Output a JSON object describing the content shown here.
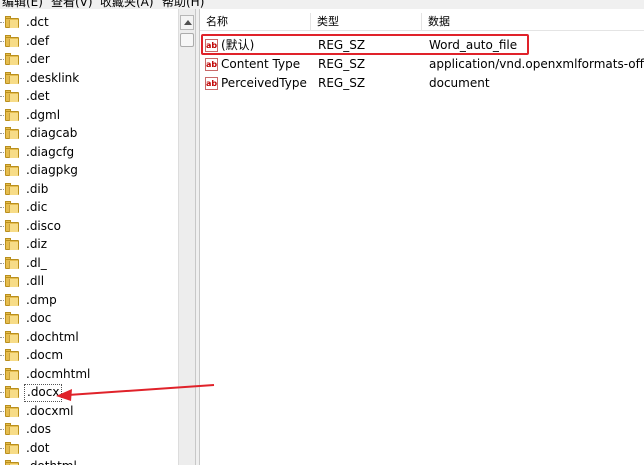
{
  "menubar": {
    "items": [
      "编辑(E)",
      "查看(V)",
      "收藏夹(A)",
      "帮助(H)"
    ]
  },
  "tree": {
    "items": [
      ".dct",
      ".def",
      ".der",
      ".desklink",
      ".det",
      ".dgml",
      ".diagcab",
      ".diagcfg",
      ".diagpkg",
      ".dib",
      ".dic",
      ".disco",
      ".diz",
      ".dl_",
      ".dll",
      ".dmp",
      ".doc",
      ".dochtml",
      ".docm",
      ".docmhtml",
      ".docx",
      ".docxml",
      ".dos",
      ".dot",
      ".dothtml"
    ],
    "selected": ".docx"
  },
  "list": {
    "columns": [
      "名称",
      "类型",
      "数据"
    ],
    "icon": "ab",
    "rows": [
      {
        "name": "(默认)",
        "type": "REG_SZ",
        "data": "Word_auto_file"
      },
      {
        "name": "Content Type",
        "type": "REG_SZ",
        "data": "application/vnd.openxmlformats-officed"
      },
      {
        "name": "PerceivedType",
        "type": "REG_SZ",
        "data": "document"
      }
    ]
  },
  "colors": {
    "annotation": "#e0222a",
    "folder": "#e6bd4f"
  }
}
